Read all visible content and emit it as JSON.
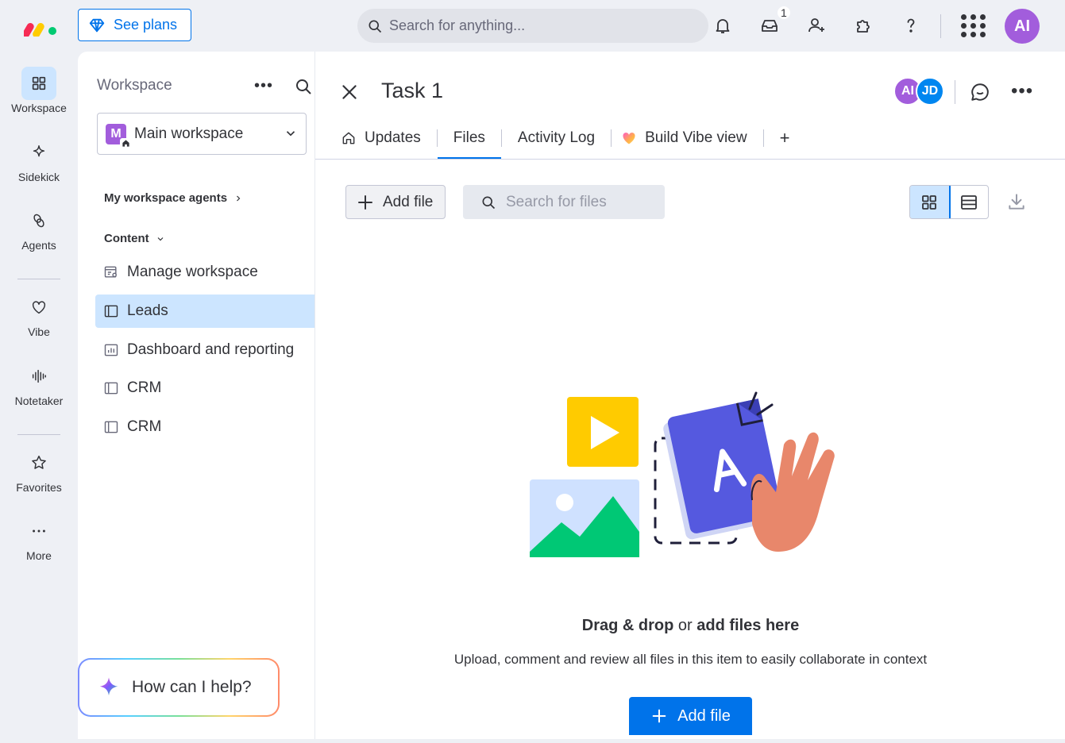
{
  "header": {
    "see_plans": "See plans",
    "search_placeholder": "Search for anything...",
    "inbox_count": "1",
    "user_initials": "AI"
  },
  "rail": {
    "items": [
      {
        "label": "Workspace",
        "icon": "grid-icon"
      },
      {
        "label": "Sidekick",
        "icon": "sparkle-icon"
      },
      {
        "label": "Agents",
        "icon": "agent-icon"
      },
      {
        "label": "Vibe",
        "icon": "heart-icon"
      },
      {
        "label": "Notetaker",
        "icon": "waveform-icon"
      },
      {
        "label": "Favorites",
        "icon": "star-icon"
      },
      {
        "label": "More",
        "icon": "more-dots-icon"
      }
    ]
  },
  "workspace": {
    "title": "Workspace",
    "selected": "Main workspace",
    "badge_letter": "M",
    "agents_section": "My workspace agents",
    "content_section": "Content",
    "items": [
      {
        "label": "Manage workspace",
        "icon": "manage-workspace-icon"
      },
      {
        "label": "Leads",
        "icon": "board-icon"
      },
      {
        "label": "Dashboard and reporting",
        "icon": "dashboard-icon"
      },
      {
        "label": "CRM",
        "icon": "board-icon"
      },
      {
        "label": "CRM",
        "icon": "board-icon"
      }
    ]
  },
  "help": {
    "label": "How can I help?"
  },
  "item": {
    "title": "Task 1",
    "avatars": [
      "AI",
      "JD"
    ],
    "tabs": [
      "Updates",
      "Files",
      "Activity Log",
      "Build Vibe view"
    ],
    "add_tab": "+"
  },
  "files": {
    "add_file": "Add file",
    "search_placeholder": "Search for files",
    "empty_title_1": "Drag & drop",
    "empty_title_or": "or",
    "empty_title_2": "add files here",
    "empty_subtitle": "Upload, comment and review all files in this item to easily collaborate in context",
    "add_file_big": "Add file"
  },
  "colors": {
    "accent": "#0073ea",
    "selected_bg": "#cce5ff",
    "avatar_ai": "#a25ddc",
    "avatar_jd": "#0086f0"
  }
}
